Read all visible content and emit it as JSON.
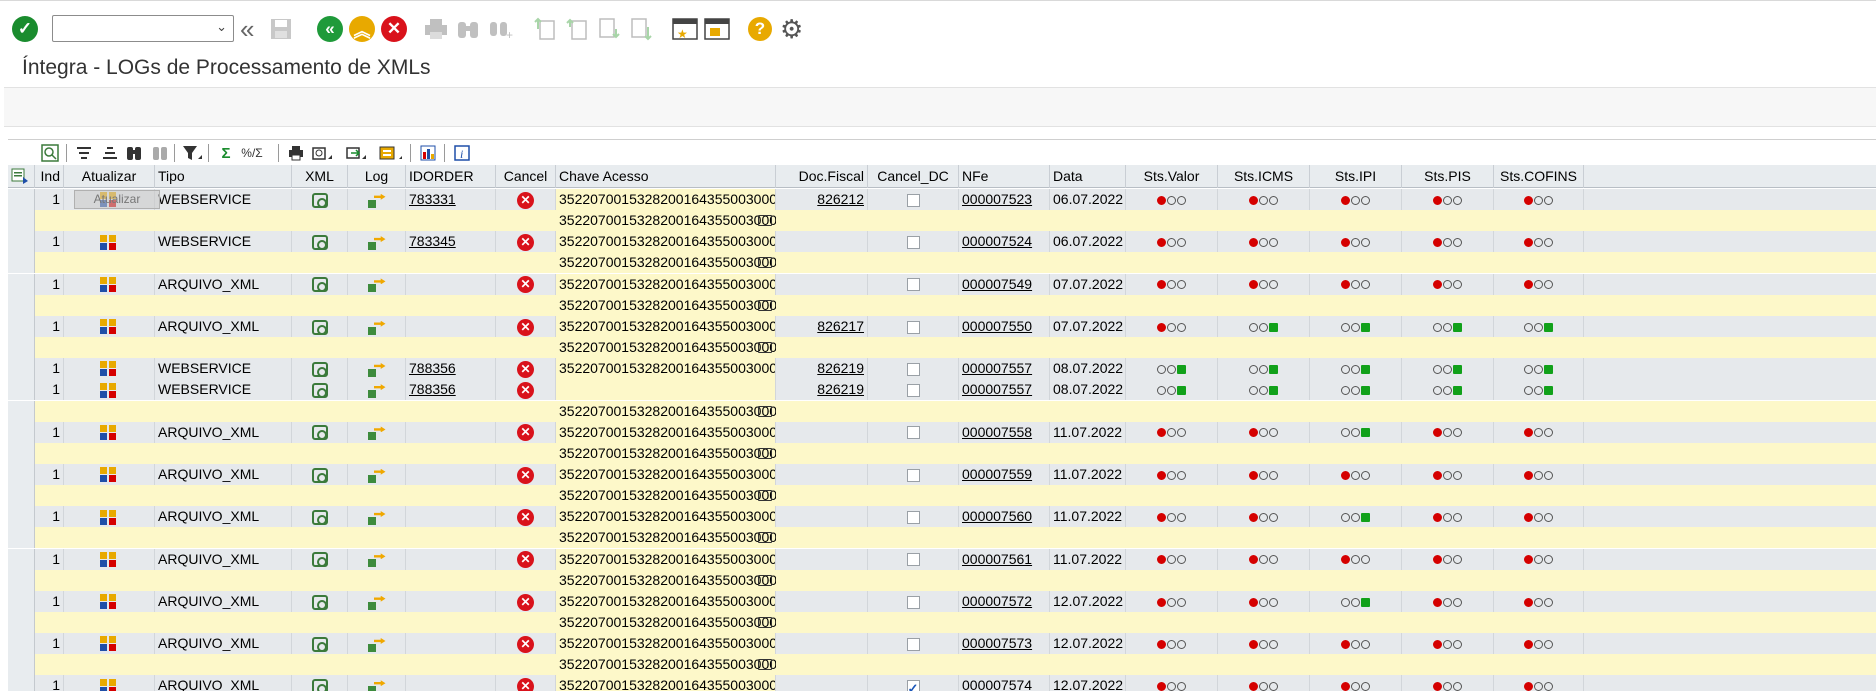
{
  "title": "Íntegra - LOGs de Processamento de XMLs",
  "command_field": {
    "value": ""
  },
  "toolbar": {
    "icons": [
      "enter-icon",
      "back-icon",
      "save-icon",
      "back-green-icon",
      "exit-icon",
      "cancel-icon",
      "print-icon",
      "find-icon",
      "find-next-icon",
      "first-page-icon",
      "prev-page-icon",
      "next-page-icon",
      "last-page-icon",
      "new-session-icon",
      "shortcut-icon",
      "help-icon",
      "settings-icon"
    ]
  },
  "alv_toolbar": {
    "icons": [
      "details-icon",
      "sort-asc-icon",
      "sort-desc-icon",
      "find-icon",
      "find-next-icon",
      "filter-icon",
      "sum-icon",
      "subtotal-icon",
      "print-icon",
      "views-icon",
      "export-icon",
      "layout-icon",
      "graphic-icon",
      "info-icon"
    ]
  },
  "columns": {
    "ind": "Ind",
    "atualizar": "Atualizar",
    "tipo": "Tipo",
    "xml": "XML",
    "log": "Log",
    "idorder": "IDORDER",
    "cancel": "Cancel",
    "chave": "Chave Acesso",
    "docfiscal": "Doc.Fiscal",
    "cancel_dc": "Cancel_DC",
    "nfe": "NFe",
    "data": "Data",
    "sts_valor": "Sts.Valor",
    "sts_icms": "Sts.ICMS",
    "sts_ipi": "Sts.IPI",
    "sts_pis": "Sts.PIS",
    "sts_cofins": "Sts.COFINS"
  },
  "tooltip": "Atualizar",
  "colors": {
    "red": "#d50000",
    "green": "#11a11a",
    "yellow_row": "#fdf8c9",
    "gray_row": "#e6e9ec"
  },
  "rows": [
    {
      "type": "main",
      "ind": "1",
      "tipo": "WEBSERVICE",
      "idorder": "783331",
      "chave": "352207001532820016435500300000007...",
      "docfiscal": "826212",
      "cancel_dc": false,
      "nfe": "000007523",
      "data": "06.07.2022",
      "lights": [
        "R",
        "R",
        "R",
        "R",
        "R"
      ]
    },
    {
      "type": "sub",
      "chave": "352207001532820016435500300000..."
    },
    {
      "type": "main",
      "ind": "1",
      "tipo": "WEBSERVICE",
      "idorder": "783345",
      "chave": "352207001532820016435500300000007...",
      "docfiscal": "",
      "cancel_dc": false,
      "nfe": "000007524",
      "data": "06.07.2022",
      "lights": [
        "R",
        "R",
        "R",
        "R",
        "R"
      ]
    },
    {
      "type": "sub",
      "chave": "352207001532820016435500300000..."
    },
    {
      "type": "main",
      "ind": "1",
      "tipo": "ARQUIVO_XML",
      "idorder": "",
      "chave": "352207001532820016435500300000007...",
      "docfiscal": "",
      "cancel_dc": false,
      "nfe": "000007549",
      "data": "07.07.2022",
      "lights": [
        "R",
        "R",
        "R",
        "R",
        "R"
      ]
    },
    {
      "type": "sub",
      "chave": "352207001532820016435500300000..."
    },
    {
      "type": "main",
      "ind": "1",
      "tipo": "ARQUIVO_XML",
      "idorder": "",
      "chave": "352207001532820016435500300000007...",
      "docfiscal": "826217",
      "cancel_dc": false,
      "nfe": "000007550",
      "data": "07.07.2022",
      "lights": [
        "R",
        "G",
        "G",
        "G",
        "G"
      ]
    },
    {
      "type": "sub",
      "chave": "352207001532820016435500300000..."
    },
    {
      "type": "main",
      "ind": "1",
      "tipo": "WEBSERVICE",
      "idorder": "788356",
      "chave": "352207001532820016435500300000007...",
      "docfiscal": "826219",
      "cancel_dc": false,
      "nfe": "000007557",
      "data": "08.07.2022",
      "lights": [
        "G",
        "G",
        "G",
        "G",
        "G"
      ]
    },
    {
      "type": "main",
      "ind": "1",
      "tipo": "WEBSERVICE",
      "idorder": "788356",
      "chave": "",
      "docfiscal": "826219",
      "cancel_dc": false,
      "nfe": "000007557",
      "data": "08.07.2022",
      "lights": [
        "G",
        "G",
        "G",
        "G",
        "G"
      ]
    },
    {
      "type": "sub",
      "chave": "352207001532820016435500300000..."
    },
    {
      "type": "main",
      "ind": "1",
      "tipo": "ARQUIVO_XML",
      "idorder": "",
      "chave": "352207001532820016435500300000007...",
      "docfiscal": "",
      "cancel_dc": false,
      "nfe": "000007558",
      "data": "11.07.2022",
      "lights": [
        "R",
        "R",
        "G",
        "R",
        "R"
      ]
    },
    {
      "type": "sub",
      "chave": "352207001532820016435500300000..."
    },
    {
      "type": "main",
      "ind": "1",
      "tipo": "ARQUIVO_XML",
      "idorder": "",
      "chave": "352207001532820016435500300000007...",
      "docfiscal": "",
      "cancel_dc": false,
      "nfe": "000007559",
      "data": "11.07.2022",
      "lights": [
        "R",
        "R",
        "R",
        "R",
        "R"
      ]
    },
    {
      "type": "sub",
      "chave": "352207001532820016435500300000..."
    },
    {
      "type": "main",
      "ind": "1",
      "tipo": "ARQUIVO_XML",
      "idorder": "",
      "chave": "352207001532820016435500300000007...",
      "docfiscal": "",
      "cancel_dc": false,
      "nfe": "000007560",
      "data": "11.07.2022",
      "lights": [
        "R",
        "R",
        "G",
        "R",
        "R"
      ]
    },
    {
      "type": "sub",
      "chave": "352207001532820016435500300000..."
    },
    {
      "type": "main",
      "ind": "1",
      "tipo": "ARQUIVO_XML",
      "idorder": "",
      "chave": "352207001532820016435500300000007...",
      "docfiscal": "",
      "cancel_dc": false,
      "nfe": "000007561",
      "data": "11.07.2022",
      "lights": [
        "R",
        "R",
        "R",
        "R",
        "R"
      ]
    },
    {
      "type": "sub",
      "chave": "352207001532820016435500300000..."
    },
    {
      "type": "main",
      "ind": "1",
      "tipo": "ARQUIVO_XML",
      "idorder": "",
      "chave": "352207001532820016435500300000007...",
      "docfiscal": "",
      "cancel_dc": false,
      "nfe": "000007572",
      "data": "12.07.2022",
      "lights": [
        "R",
        "R",
        "G",
        "R",
        "R"
      ]
    },
    {
      "type": "sub",
      "chave": "352207001532820016435500300000..."
    },
    {
      "type": "main",
      "ind": "1",
      "tipo": "ARQUIVO_XML",
      "idorder": "",
      "chave": "352207001532820016435500300000007...",
      "docfiscal": "",
      "cancel_dc": false,
      "nfe": "000007573",
      "data": "12.07.2022",
      "lights": [
        "R",
        "R",
        "R",
        "R",
        "R"
      ]
    },
    {
      "type": "sub",
      "chave": "352207001532820016435500300000..."
    },
    {
      "type": "main",
      "ind": "1",
      "tipo": "ARQUIVO_XML",
      "idorder": "",
      "chave": "352207001532820016435500300000007...",
      "docfiscal": "",
      "cancel_dc": true,
      "nfe": "000007574",
      "data": "12.07.2022",
      "lights": [
        "R",
        "R",
        "R",
        "R",
        "R"
      ]
    }
  ]
}
